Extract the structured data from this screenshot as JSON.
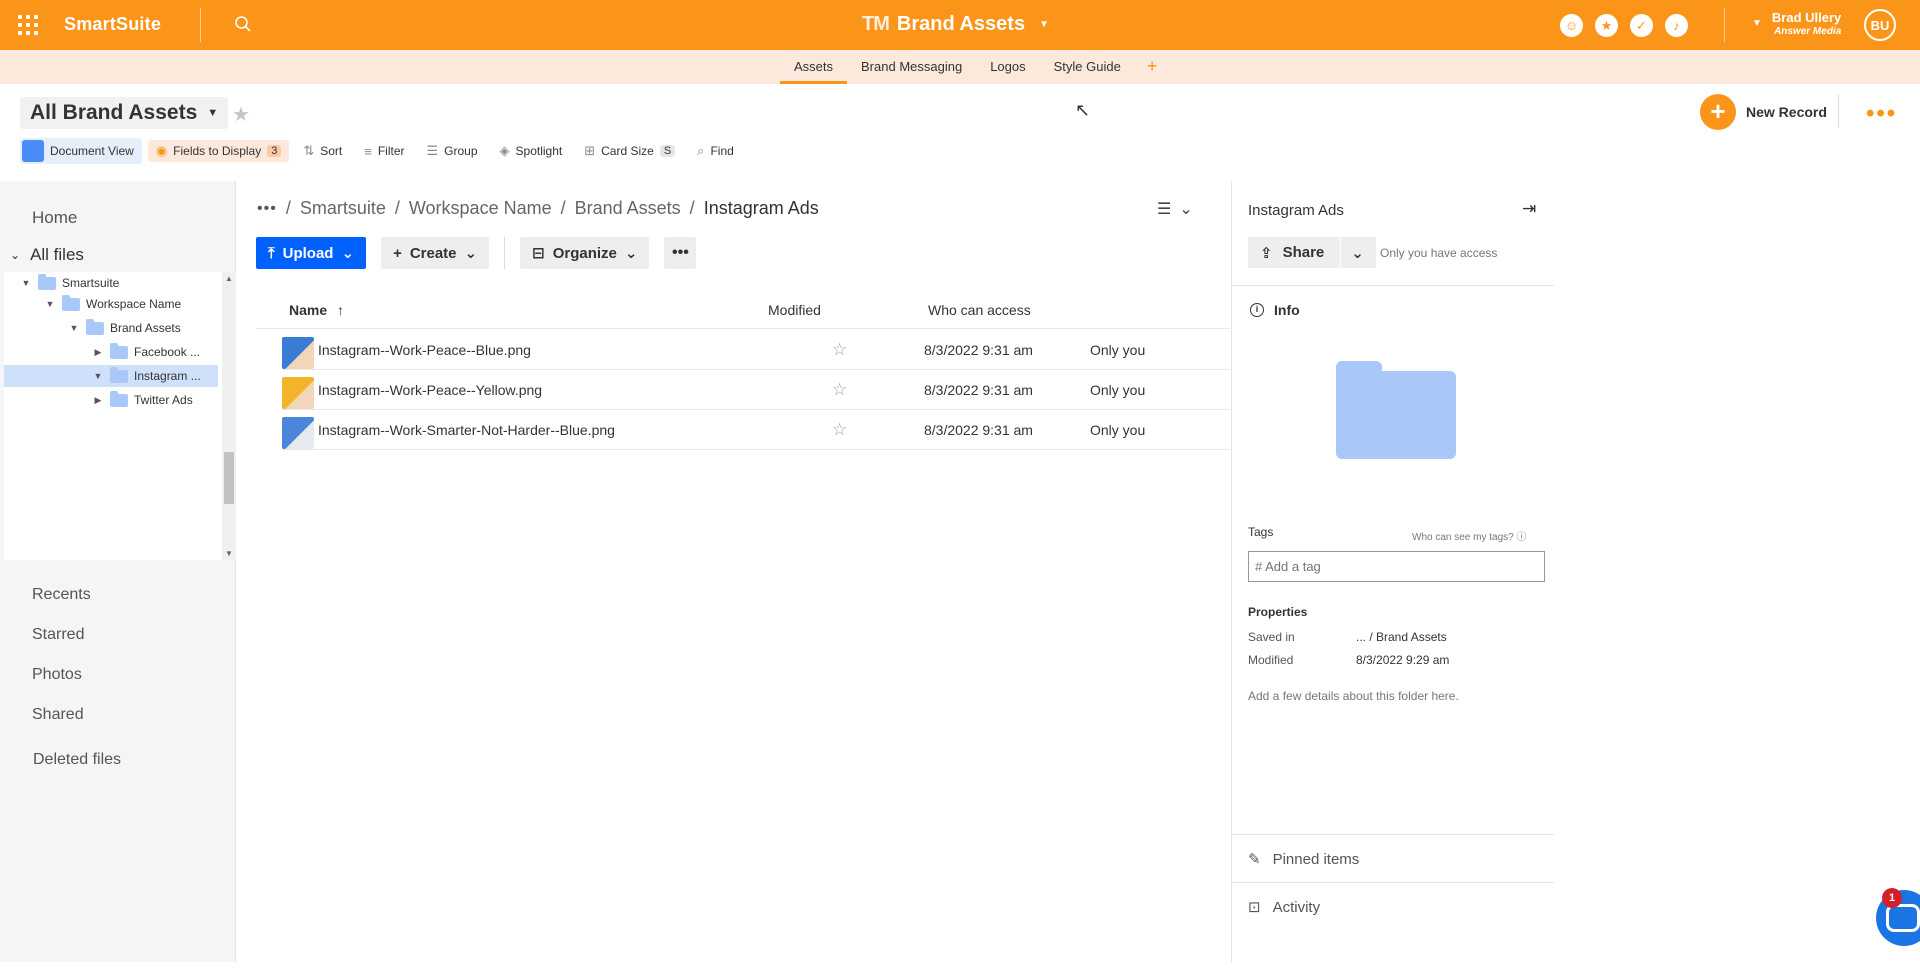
{
  "app": {
    "logo": "SmartSuite",
    "title_prefix": "TM",
    "title": "Brand Assets"
  },
  "user": {
    "name": "Brad Ullery",
    "org": "Answer Media",
    "initials": "BU"
  },
  "tabs": [
    {
      "label": "Assets",
      "active": true
    },
    {
      "label": "Brand Messaging"
    },
    {
      "label": "Logos"
    },
    {
      "label": "Style Guide"
    }
  ],
  "tab_add": "+",
  "view": {
    "title": "All Brand Assets"
  },
  "new_record": "New Record",
  "toolbar": {
    "document_view": "Document View",
    "fields_to_display": "Fields to Display",
    "fields_count": "3",
    "sort": "Sort",
    "filter": "Filter",
    "group": "Group",
    "spotlight": "Spotlight",
    "card_size": "Card Size",
    "card_size_value": "S",
    "find": "Find"
  },
  "sidebar": {
    "home": "Home",
    "all_files": "All files",
    "tree": [
      {
        "label": "Smartsuite"
      },
      {
        "label": "Workspace Name"
      },
      {
        "label": "Brand Assets"
      },
      {
        "label": "Facebook ..."
      },
      {
        "label": "Instagram ...",
        "selected": true
      },
      {
        "label": "Twitter Ads"
      }
    ],
    "recents": "Recents",
    "starred": "Starred",
    "photos": "Photos",
    "shared": "Shared",
    "deleted": "Deleted files"
  },
  "breadcrumb": [
    "Smartsuite",
    "Workspace Name",
    "Brand Assets",
    "Instagram Ads"
  ],
  "actions": {
    "upload": "Upload",
    "create": "Create",
    "organize": "Organize"
  },
  "table": {
    "headers": {
      "name": "Name",
      "modified": "Modified",
      "access": "Who can access"
    },
    "rows": [
      {
        "name": "Instagram--Work-Peace--Blue.png",
        "modified": "8/3/2022 9:31 am",
        "access": "Only you",
        "thumb_color": "#3a7bd5"
      },
      {
        "name": "Instagram--Work-Peace--Yellow.png",
        "modified": "8/3/2022 9:31 am",
        "access": "Only you",
        "thumb_color": "#f4b42a"
      },
      {
        "name": "Instagram--Work-Smarter-Not-Harder--Blue.png",
        "modified": "8/3/2022 9:31 am",
        "access": "Only you",
        "thumb_color": "#4a86d9"
      }
    ]
  },
  "panel": {
    "title": "Instagram Ads",
    "share": "Share",
    "access_note": "Only you have access",
    "info": "Info",
    "tags_label": "Tags",
    "tags_help": "Who can see my tags?",
    "tag_placeholder": "# Add a tag",
    "properties": "Properties",
    "saved_in_label": "Saved in",
    "saved_in_value": "... / Brand Assets",
    "modified_label": "Modified",
    "modified_value": "8/3/2022 9:29 am",
    "details": "Add a few details about this folder here.",
    "pinned": "Pinned items",
    "activity": "Activity"
  },
  "chat": {
    "badge": "1"
  },
  "colors": {
    "brand": "#fb9519",
    "primary": "#0061fe",
    "folder": "#a9c8f7"
  }
}
